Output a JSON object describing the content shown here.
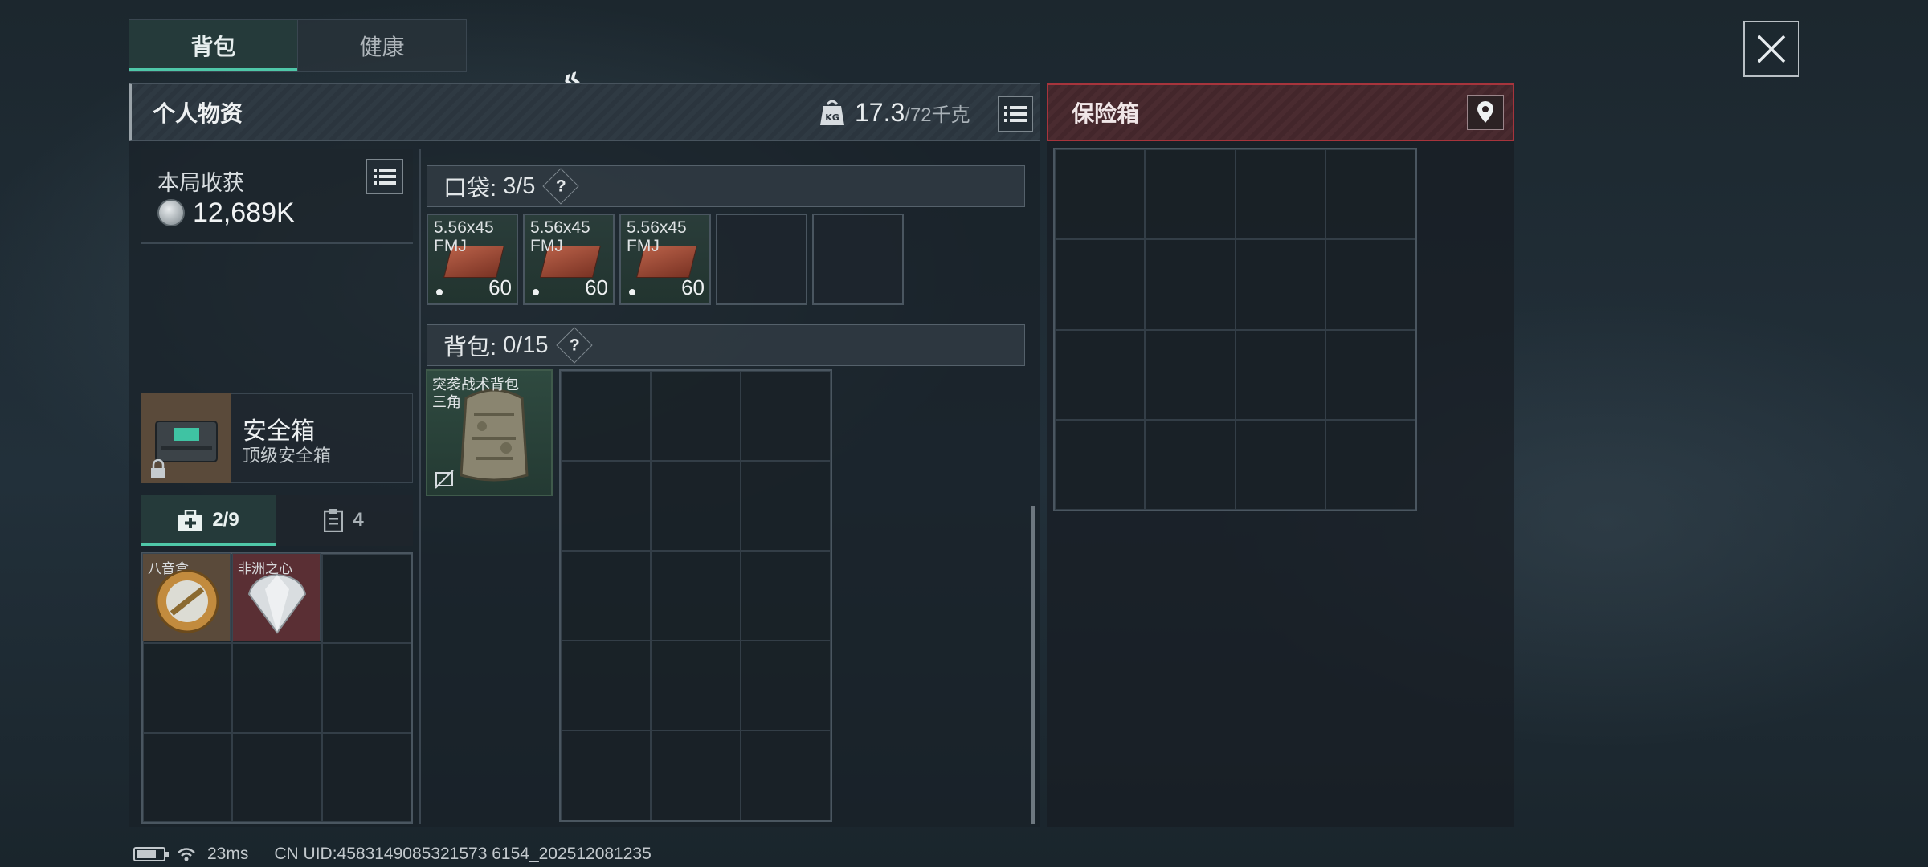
{
  "tabs": {
    "bag": "背包",
    "health": "健康"
  },
  "personal": {
    "title": "个人物资",
    "weight_current": "17.3",
    "weight_max": "/72千克",
    "weight_icon_text": "KG"
  },
  "loot": {
    "label": "本局收获",
    "value": "12,689K"
  },
  "safe_box": {
    "title": "安全箱",
    "subtitle": "顶级安全箱"
  },
  "container_tabs": [
    {
      "label": "2/9",
      "icon": "medkit-icon"
    },
    {
      "label": "4",
      "icon": "clipboard-icon"
    }
  ],
  "container_items": [
    {
      "label": "八音盒",
      "color": "#5a4a3a"
    },
    {
      "label": "非洲之心",
      "color": "#5a2f34"
    }
  ],
  "pocket": {
    "label": "口袋:",
    "count": "3/5",
    "help": "?",
    "items": [
      {
        "name": "5.56x45 FMJ",
        "count": "60"
      },
      {
        "name": "5.56x45 FMJ",
        "count": "60"
      },
      {
        "name": "5.56x45 FMJ",
        "count": "60"
      }
    ]
  },
  "backpack": {
    "label": "背包:",
    "count": "0/15",
    "help": "?",
    "item_name": "突袭战术背包 三角"
  },
  "insurance": {
    "title": "保险箱"
  },
  "status": {
    "ping": "23ms",
    "uid": "CN UID:4583149085321573 6154_202512081235"
  },
  "colors": {
    "accent": "#4fc7a8",
    "danger": "#a7343c"
  }
}
